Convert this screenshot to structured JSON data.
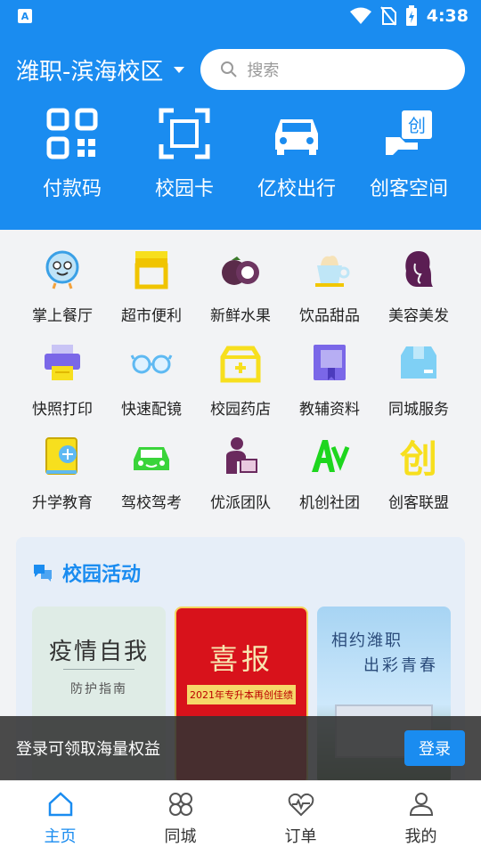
{
  "status": {
    "app_badge": "A",
    "time": "4:38"
  },
  "header": {
    "campus": "潍职-滨海校区",
    "search_placeholder": "搜索",
    "quick": [
      {
        "label": "付款码",
        "icon": "qr-code-icon"
      },
      {
        "label": "校园卡",
        "icon": "scan-frame-icon"
      },
      {
        "label": "亿校出行",
        "icon": "car-icon"
      },
      {
        "label": "创客空间",
        "icon": "maker-hand-icon"
      }
    ]
  },
  "grid": [
    {
      "label": "掌上餐厅",
      "icon": "restaurant-mascot-icon"
    },
    {
      "label": "超市便利",
      "icon": "store-icon"
    },
    {
      "label": "新鲜水果",
      "icon": "mangosteen-icon"
    },
    {
      "label": "饮品甜品",
      "icon": "drink-cup-icon"
    },
    {
      "label": "美容美发",
      "icon": "hair-silhouette-icon"
    },
    {
      "label": "快照打印",
      "icon": "printer-icon"
    },
    {
      "label": "快速配镜",
      "icon": "glasses-icon"
    },
    {
      "label": "校园药店",
      "icon": "medicine-box-icon"
    },
    {
      "label": "教辅资料",
      "icon": "book-icon"
    },
    {
      "label": "同城服务",
      "icon": "box-icon"
    },
    {
      "label": "升学教育",
      "icon": "education-book-icon"
    },
    {
      "label": "驾校驾考",
      "icon": "driving-car-icon"
    },
    {
      "label": "优派团队",
      "icon": "delivery-person-icon"
    },
    {
      "label": "机创社团",
      "icon": "av-logo-icon"
    },
    {
      "label": "创客联盟",
      "icon": "chuang-logo-icon"
    }
  ],
  "activity": {
    "title": "校园活动",
    "cards": [
      {
        "title": "疫情自我",
        "subtitle": "防护指南"
      },
      {
        "title": "喜报",
        "subtitle": "2021年专升本再创佳绩"
      },
      {
        "title": "相约潍职",
        "subtitle": "出彩青春"
      }
    ]
  },
  "login": {
    "text": "登录可领取海量权益",
    "button": "登录"
  },
  "tabs": [
    {
      "label": "主页",
      "icon": "home-icon",
      "active": true
    },
    {
      "label": "同城",
      "icon": "four-leaf-icon",
      "active": false
    },
    {
      "label": "订单",
      "icon": "heart-pulse-icon",
      "active": false
    },
    {
      "label": "我的",
      "icon": "user-icon",
      "active": false
    }
  ]
}
